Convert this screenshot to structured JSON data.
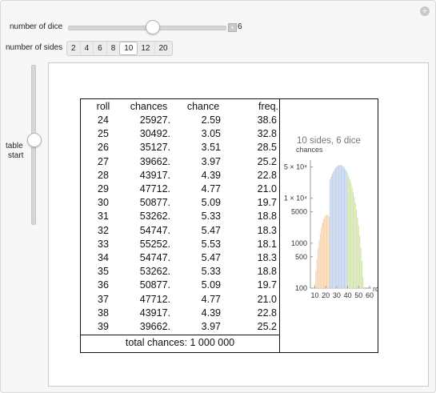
{
  "controls": {
    "dice_label": "number of dice",
    "dice_value": "6",
    "dice_plus": "+",
    "sides_label": "number of sides",
    "sides_options": [
      "2",
      "4",
      "6",
      "8",
      "10",
      "12",
      "20"
    ],
    "sides_selected": "10",
    "table_start_label_1": "table",
    "table_start_label_2": "start",
    "corner_plus": "+"
  },
  "table": {
    "headers": [
      "roll",
      "chances",
      "chance",
      "freq."
    ],
    "rows": [
      [
        "24",
        "25927.",
        "2.59",
        "38.6"
      ],
      [
        "25",
        "30492.",
        "3.05",
        "32.8"
      ],
      [
        "26",
        "35127.",
        "3.51",
        "28.5"
      ],
      [
        "27",
        "39662.",
        "3.97",
        "25.2"
      ],
      [
        "28",
        "43917.",
        "4.39",
        "22.8"
      ],
      [
        "29",
        "47712.",
        "4.77",
        "21.0"
      ],
      [
        "30",
        "50877.",
        "5.09",
        "19.7"
      ],
      [
        "31",
        "53262.",
        "5.33",
        "18.8"
      ],
      [
        "32",
        "54747.",
        "5.47",
        "18.3"
      ],
      [
        "33",
        "55252.",
        "5.53",
        "18.1"
      ],
      [
        "34",
        "54747.",
        "5.47",
        "18.3"
      ],
      [
        "35",
        "53262.",
        "5.33",
        "18.8"
      ],
      [
        "36",
        "50877.",
        "5.09",
        "19.7"
      ],
      [
        "37",
        "47712.",
        "4.77",
        "21.0"
      ],
      [
        "38",
        "43917.",
        "4.39",
        "22.8"
      ],
      [
        "39",
        "39662.",
        "3.97",
        "25.2"
      ]
    ],
    "total": "total chances: 1 000 000"
  },
  "chart_data": {
    "type": "area",
    "title": "10 sides, 6 dice",
    "ylabel": "chances",
    "xlabel": "roll",
    "yscale": "log",
    "x_ticks": [
      "10",
      "20",
      "30",
      "40",
      "50",
      "60"
    ],
    "y_ticks": [
      "100",
      "500",
      "1000",
      "5000",
      "1 × 10⁴",
      "5 × 10⁴"
    ],
    "xlim": [
      6,
      60
    ],
    "ylim": [
      100,
      60000
    ],
    "highlight_range": [
      24,
      39
    ],
    "colors": {
      "low": "#f4c48e",
      "mid": "#a9c2e6",
      "high": "#c2db8f"
    },
    "series": [
      {
        "x": [
          6,
          7,
          8,
          9,
          10,
          11,
          12,
          13,
          14,
          15,
          16,
          17,
          18,
          19,
          20,
          21,
          22,
          23,
          24,
          25,
          26,
          27,
          28,
          29,
          30,
          31,
          32,
          33,
          34,
          35,
          36,
          37,
          38,
          39,
          40,
          41,
          42,
          43,
          44,
          45,
          46,
          47,
          48,
          49,
          50,
          51,
          52,
          53,
          54,
          55,
          56,
          57,
          58,
          59,
          60
        ],
        "values": [
          1,
          6,
          21,
          56,
          126,
          252,
          456,
          756,
          1161,
          1666,
          2247,
          2856,
          3431,
          3906,
          4221,
          4332,
          4221,
          3906,
          25927,
          30492,
          35127,
          39662,
          43917,
          47712,
          50877,
          53262,
          54747,
          55252,
          54747,
          53262,
          50877,
          47712,
          43917,
          39662,
          35127,
          30492,
          25927,
          21582,
          17567,
          13902,
          10677,
          7902,
          5607,
          3792,
          2427,
          1452,
          802,
          402,
          177,
          66,
          21,
          6,
          1,
          0,
          0
        ]
      }
    ]
  }
}
